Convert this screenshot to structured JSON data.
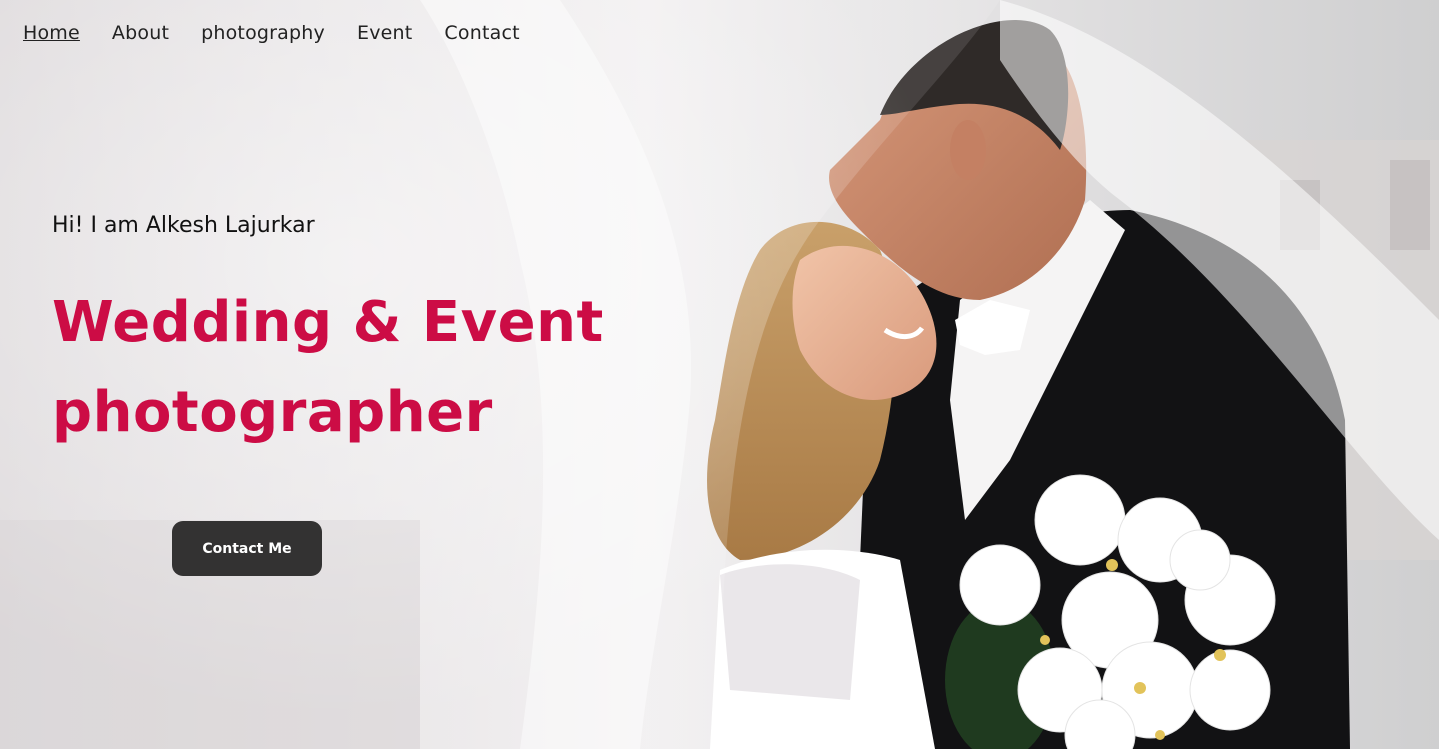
{
  "nav": {
    "items": [
      {
        "label": "Home",
        "active": true
      },
      {
        "label": "About",
        "active": false
      },
      {
        "label": "photography",
        "active": false
      },
      {
        "label": "Event",
        "active": false
      },
      {
        "label": "Contact",
        "active": false
      }
    ]
  },
  "hero": {
    "intro": "Hi! I am Alkesh Lajurkar",
    "headline_line1": "Wedding & Event",
    "headline_line2": "photographer",
    "cta_label": "Contact Me"
  },
  "colors": {
    "accent": "#cc0c45",
    "button_bg": "#333232",
    "nav_text": "#222222"
  }
}
